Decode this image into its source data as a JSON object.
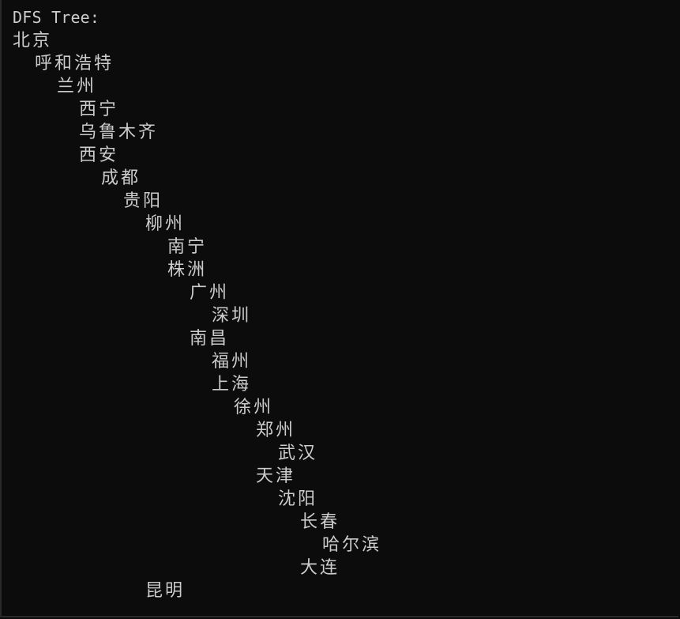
{
  "console": {
    "header": "DFS Tree:",
    "nodes": [
      {
        "label": "北京",
        "depth": 0
      },
      {
        "label": "呼和浩特",
        "depth": 1
      },
      {
        "label": "兰州",
        "depth": 2
      },
      {
        "label": "西宁",
        "depth": 3
      },
      {
        "label": "乌鲁木齐",
        "depth": 3
      },
      {
        "label": "西安",
        "depth": 3
      },
      {
        "label": "成都",
        "depth": 4
      },
      {
        "label": "贵阳",
        "depth": 5
      },
      {
        "label": "柳州",
        "depth": 6
      },
      {
        "label": "南宁",
        "depth": 7
      },
      {
        "label": "株洲",
        "depth": 7
      },
      {
        "label": "广州",
        "depth": 8
      },
      {
        "label": "深圳",
        "depth": 9
      },
      {
        "label": "南昌",
        "depth": 8
      },
      {
        "label": "福州",
        "depth": 9
      },
      {
        "label": "上海",
        "depth": 9
      },
      {
        "label": "徐州",
        "depth": 10
      },
      {
        "label": "郑州",
        "depth": 11
      },
      {
        "label": "武汉",
        "depth": 12
      },
      {
        "label": "天津",
        "depth": 11
      },
      {
        "label": "沈阳",
        "depth": 12
      },
      {
        "label": "长春",
        "depth": 13
      },
      {
        "label": "哈尔滨",
        "depth": 14
      },
      {
        "label": "大连",
        "depth": 13
      },
      {
        "label": "昆明",
        "depth": 6
      }
    ]
  }
}
